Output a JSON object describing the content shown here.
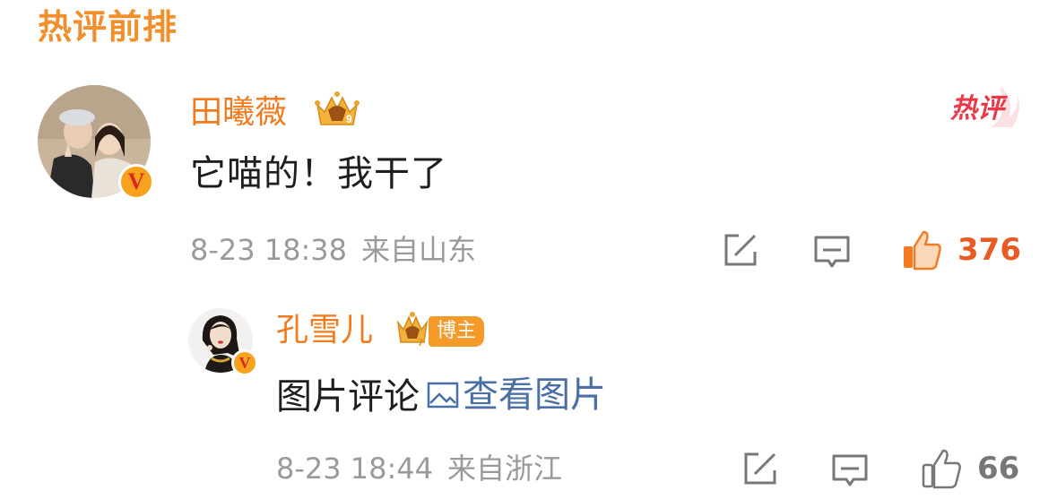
{
  "section": {
    "title": "热评前排"
  },
  "comments": [
    {
      "username": "田曦薇",
      "crown_level": "9",
      "hot_tag": "热评",
      "text": "它喵的！我干了",
      "date": "8-23 18:38",
      "location": "来自山东",
      "likes": "376",
      "liked": true
    }
  ],
  "reply": {
    "username": "孔雪儿",
    "crown_level": "7",
    "badge": "博主",
    "text_prefix": "图片评论",
    "link_text": "查看图片",
    "date": "8-23 18:44",
    "location": "来自浙江",
    "likes": "66",
    "liked": false
  },
  "icons": {
    "share": "share-icon",
    "comment": "comment-icon",
    "like": "thumbs-up-icon",
    "picture": "picture-icon",
    "verified": "verified-badge-icon"
  },
  "colors": {
    "accent_orange": "#f07a1e",
    "title_orange": "#f08f2c",
    "hot_red": "#e83a4a",
    "link_blue": "#4a6fa5",
    "meta_gray": "#9a9a9a",
    "verified_yellow": "#f7a21c"
  }
}
